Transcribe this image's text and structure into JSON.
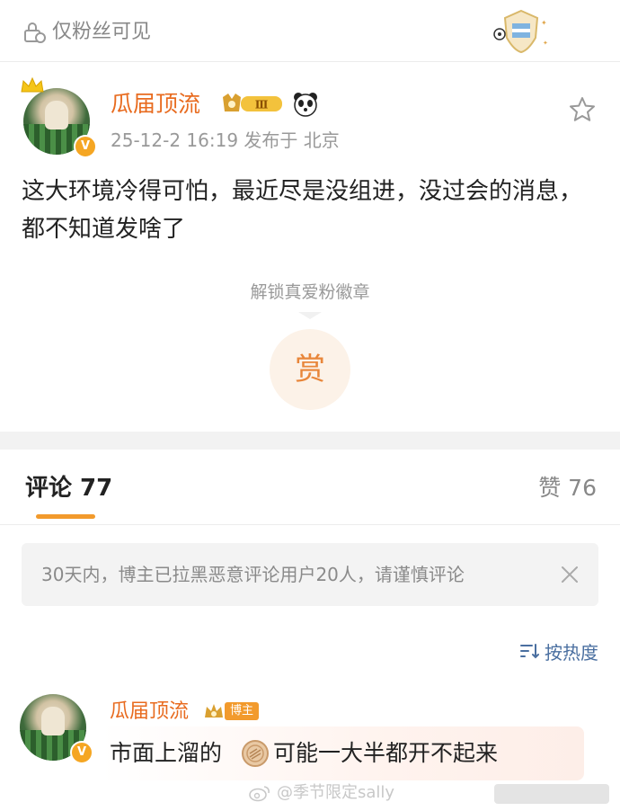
{
  "visibility": {
    "label": "仅粉丝可见"
  },
  "post": {
    "username": "瓜届顶流",
    "level_badge": "Ⅲ",
    "verified_mark": "V",
    "time_location": "25-12-2 16:19  发布于 北京",
    "body": "这大环境冷得可怕，最近尽是没组进，没过会的消息，都不知道发啥了",
    "unlock_badge_text": "解锁真爱粉徽章",
    "reward_label": "赏"
  },
  "comments_section": {
    "tab_label": "评论 77",
    "likes_label": "赞 76",
    "notice": "30天内，博主已拉黑恶意评论用户20人，请谨慎评论",
    "sort_label": "按热度"
  },
  "comment": {
    "username": "瓜届顶流",
    "author_badge": "博主",
    "verified_mark": "V",
    "text_before": "市面上溜的",
    "text_after": "可能一大半都开不起来"
  },
  "watermark": {
    "text": "@季节限定sally"
  },
  "colors": {
    "accent_orange": "#e86b1f",
    "tab_underline": "#f29a2c",
    "link_blue": "#4a6fa0",
    "muted_gray": "#999999"
  },
  "icons": {
    "lock": "lock-icon",
    "star": "star-icon",
    "crown": "crown-icon",
    "panda": "panda-icon",
    "close": "close-icon",
    "sort": "sort-icon",
    "coin": "coin-icon",
    "weibo": "weibo-icon"
  }
}
